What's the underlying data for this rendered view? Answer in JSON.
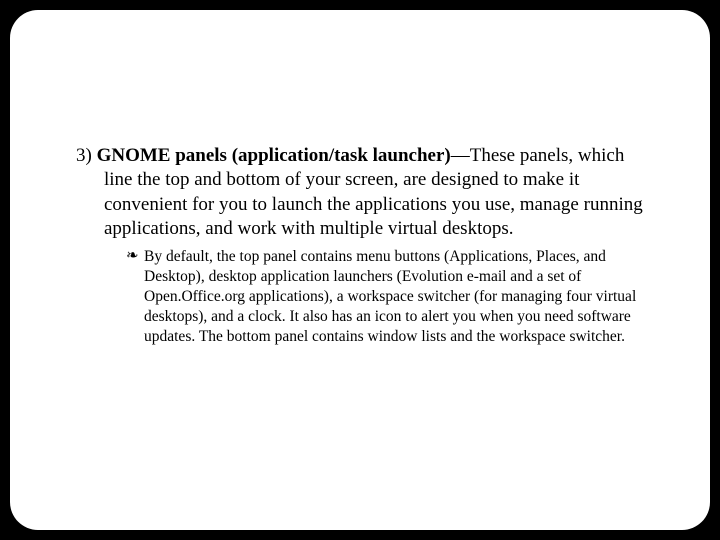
{
  "slide": {
    "item": {
      "number": "3) ",
      "title_bold": "GNOME panels (application/task launcher)",
      "body": "—These panels, which line the top and bottom of your screen, are designed to make it convenient for you to launch the applications you use, manage running applications, and work with multiple virtual desktops."
    },
    "sub": {
      "bullet": "❧",
      "text": "By default, the top panel contains menu buttons (Applications, Places, and Desktop), desktop application launchers (Evolution e-mail and a set of Open.Office.org applications), a workspace switcher (for managing four virtual desktops), and a clock. It also has an icon to alert you when you need software updates. The bottom panel contains window lists and the workspace switcher."
    }
  }
}
